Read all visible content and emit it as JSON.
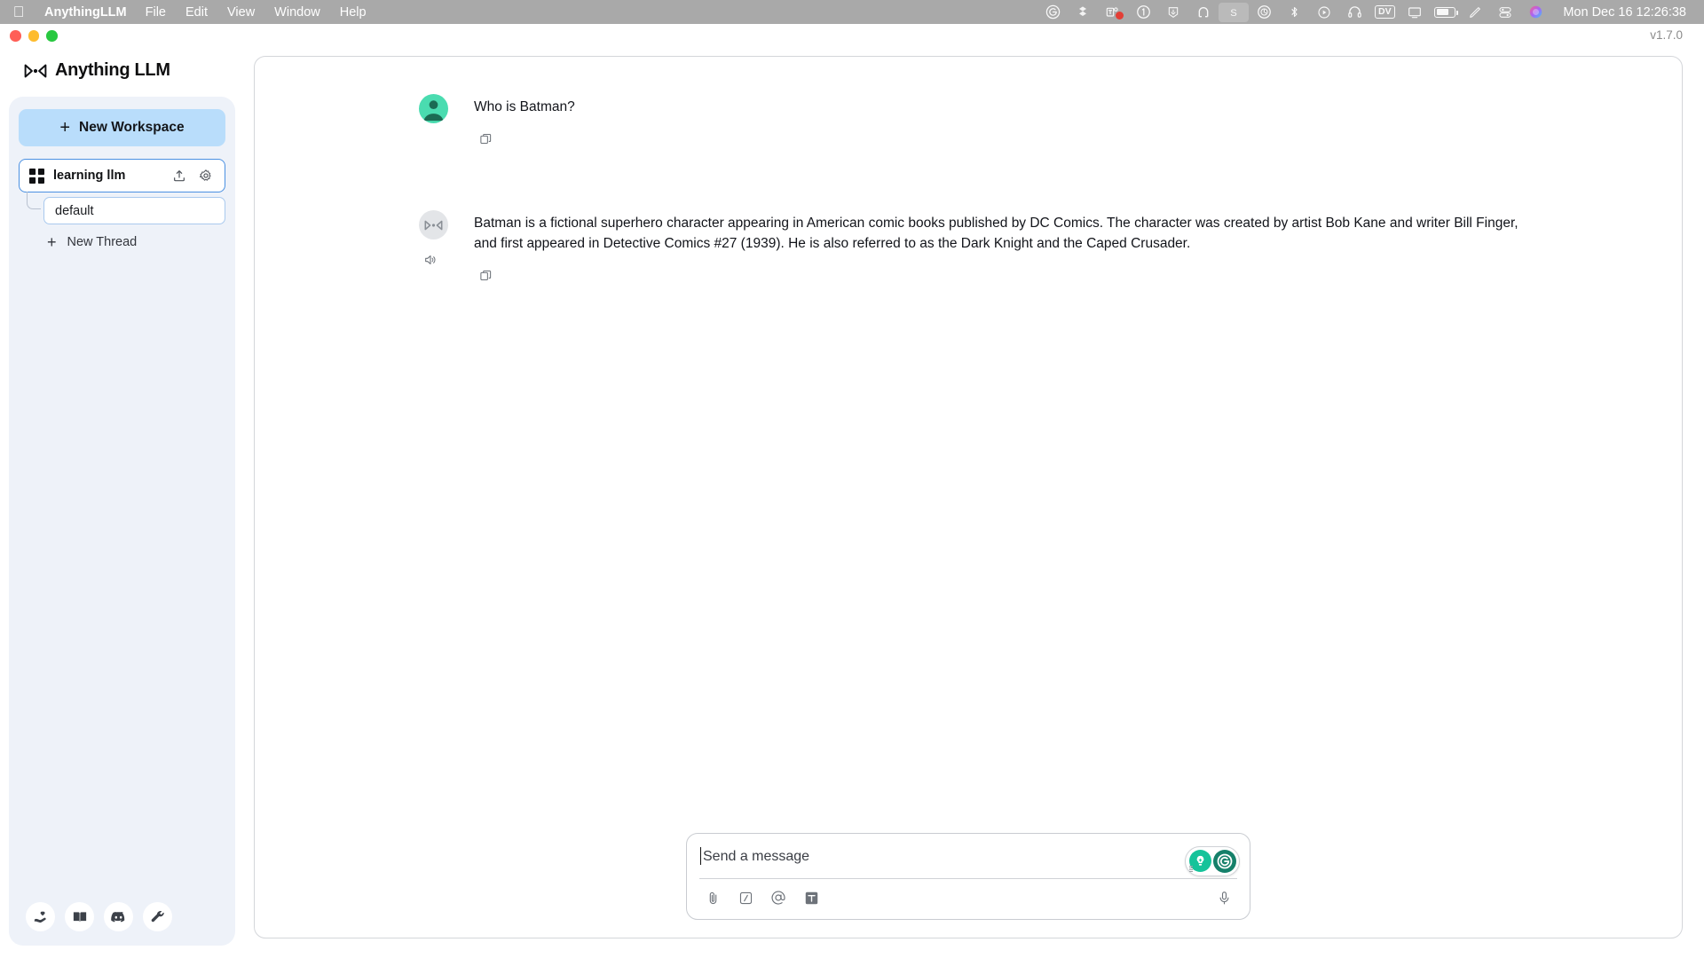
{
  "menubar": {
    "apple_icon": "apple-logo",
    "app_name": "AnythingLLM",
    "items": [
      "File",
      "Edit",
      "View",
      "Window",
      "Help"
    ],
    "tray_icons": [
      "grammarly-icon",
      "dropbox-icon",
      "microsoft-teams-icon",
      "1password-icon",
      "hidden-bar-icon",
      "magnet-icon",
      "shottr-icon",
      "time-machine-icon",
      "bluetooth-icon",
      "playback-icon",
      "headphones-icon",
      "dv-icon",
      "display-icon",
      "battery-icon",
      "pencil-icon",
      "control-center-icon",
      "siri-icon"
    ],
    "clock": "Mon Dec 16  12:26:38"
  },
  "window": {
    "traffic_lights": [
      "close",
      "minimize",
      "maximize"
    ],
    "version": "v1.7.0"
  },
  "sidebar": {
    "brand": "Anything LLM",
    "new_workspace_label": "New Workspace",
    "new_workspace_icon": "plus-icon",
    "workspace": {
      "icon": "grid-squares-icon",
      "name": "learning llm",
      "upload_icon": "upload-icon",
      "settings_icon": "gear-icon"
    },
    "thread": {
      "name": "default"
    },
    "new_thread_label": "New Thread",
    "new_thread_icon": "plus-icon",
    "footer_icons": [
      "hand-heart-icon",
      "book-icon",
      "discord-icon",
      "wrench-icon"
    ]
  },
  "chat": {
    "messages": [
      {
        "role": "user",
        "avatar": "user-avatar",
        "text": "Who is Batman?",
        "copy_icon": "copy-icon"
      },
      {
        "role": "assistant",
        "avatar": "anythingllm-avatar",
        "text": "Batman is a fictional superhero character appearing in American comic books published by DC Comics. The character was created by artist Bob Kane and writer Bill Finger, and first appeared in Detective Comics #27 (1939). He is also referred to as the Dark Knight and the Caped Crusader.",
        "copy_icon": "copy-icon",
        "speaker_icon": "speaker-icon"
      }
    ]
  },
  "composer": {
    "placeholder": "Send a message",
    "tools": [
      "attachment-paperclip-icon",
      "slash-command-icon",
      "at-mention-icon",
      "text-size-icon"
    ],
    "microphone_icon": "microphone-icon",
    "grammarly": {
      "bulb_icon": "grammarly-suggestion-bulb-icon",
      "logo_label": "G"
    }
  }
}
